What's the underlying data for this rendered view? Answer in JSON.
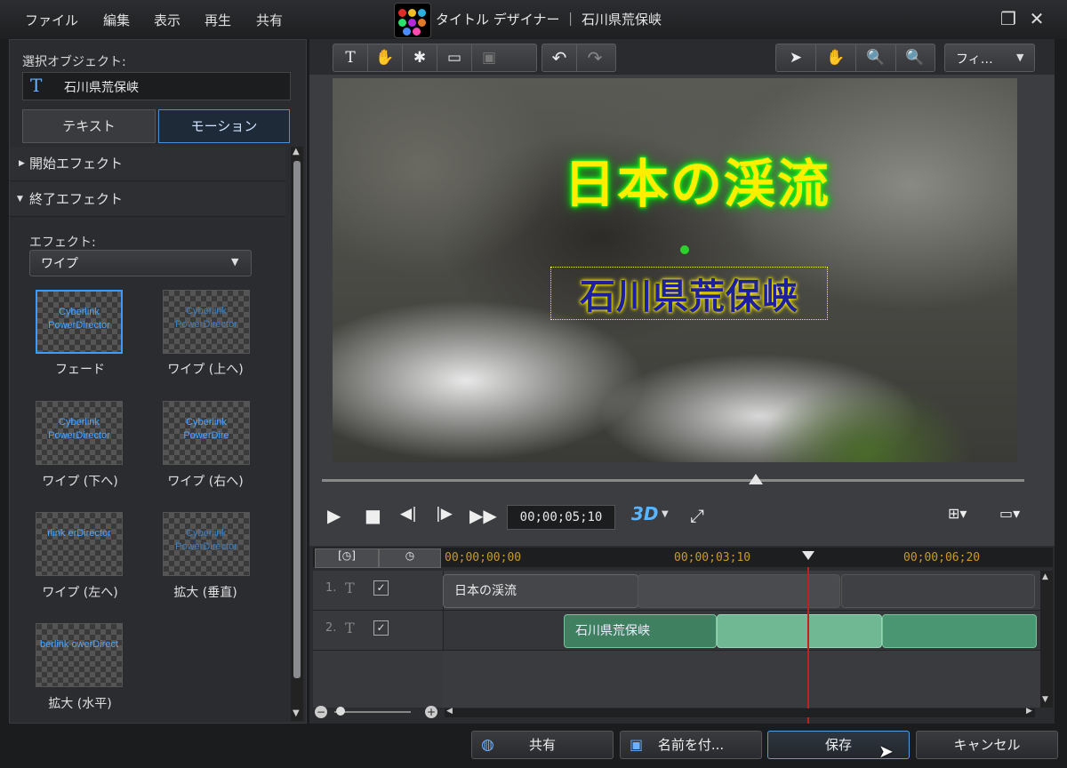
{
  "menu": [
    "ファイル",
    "編集",
    "表示",
    "再生",
    "共有"
  ],
  "window": {
    "title": "タイトル デザイナー ｜ 石川県荒保峡",
    "restore_icon": "❐",
    "close_icon": "✕"
  },
  "left": {
    "selected_object_label": "選択オブジェクト:",
    "selected_object_icon": "T",
    "selected_object_value": "石川県荒保峡",
    "tabs": [
      "テキスト",
      "モーション"
    ],
    "sections": [
      {
        "label": "開始エフェクト",
        "arrow": "▶"
      },
      {
        "label": "終了エフェクト",
        "arrow": "▼"
      }
    ],
    "effect_label": "エフェクト:",
    "effect_value": "ワイプ",
    "thumb_captions": [
      "Cyberlink PowerDirector",
      "Cyberlink PowerDirector",
      "Cyberlink PowerDirector",
      "Cyberlink PowerDire",
      "rlink erDirector",
      "Cyberlink PowerDirector",
      "berlink owerDirect"
    ],
    "effects": [
      "フェード",
      "ワイプ (上へ)",
      "ワイプ (下へ)",
      "ワイプ (右へ)",
      "ワイプ (左へ)",
      "拡大 (垂直)",
      "拡大 (水平)"
    ]
  },
  "toolbar": {
    "fit_label": "フィ…"
  },
  "preview": {
    "title": "日本の渓流",
    "subtitle": "石川県荒保峡"
  },
  "playback": {
    "timecode": "00;00;05;10",
    "mode_3d": "3D"
  },
  "timeline": {
    "timecodes": [
      "00;00;00;00",
      "00;00;03;10",
      "00;00;06;20"
    ],
    "tracks": [
      {
        "number": "1.",
        "clip": "日本の渓流"
      },
      {
        "number": "2.",
        "clip": "石川県荒保峡"
      }
    ]
  },
  "buttons": {
    "share": "共有",
    "save_as": "名前を付...",
    "save": "保存",
    "cancel": "キャンセル"
  }
}
